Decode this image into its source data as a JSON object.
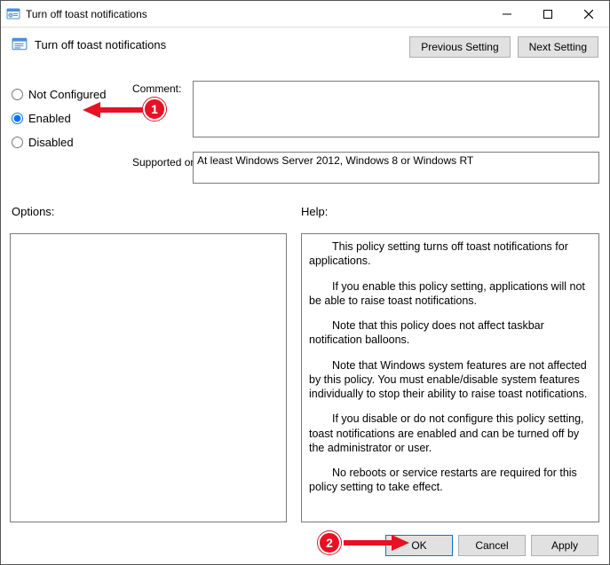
{
  "titlebar": {
    "title": "Turn off toast notifications"
  },
  "policy": {
    "title": "Turn off toast notifications"
  },
  "nav": {
    "previous": "Previous Setting",
    "next": "Next Setting"
  },
  "radios": {
    "not_configured": "Not Configured",
    "enabled": "Enabled",
    "disabled": "Disabled",
    "selected": "enabled"
  },
  "labels": {
    "comment": "Comment:",
    "supported": "Supported on:",
    "options": "Options:",
    "help": "Help:"
  },
  "supported_text": "At least Windows Server 2012, Windows 8 or Windows RT",
  "help": {
    "p1": "This policy setting turns off toast notifications for applications.",
    "p2": "If you enable this policy setting, applications will not be able to raise toast notifications.",
    "p3": "Note that this policy does not affect taskbar notification balloons.",
    "p4": "Note that Windows system features are not affected by this policy.  You must enable/disable system features individually to stop their ability to raise toast notifications.",
    "p5": "If you disable or do not configure this policy setting, toast notifications are enabled and can be turned off by the administrator or user.",
    "p6": "No reboots or service restarts are required for this policy setting to take effect."
  },
  "buttons": {
    "ok": "OK",
    "cancel": "Cancel",
    "apply": "Apply"
  },
  "badges": {
    "b1": "1",
    "b2": "2"
  }
}
